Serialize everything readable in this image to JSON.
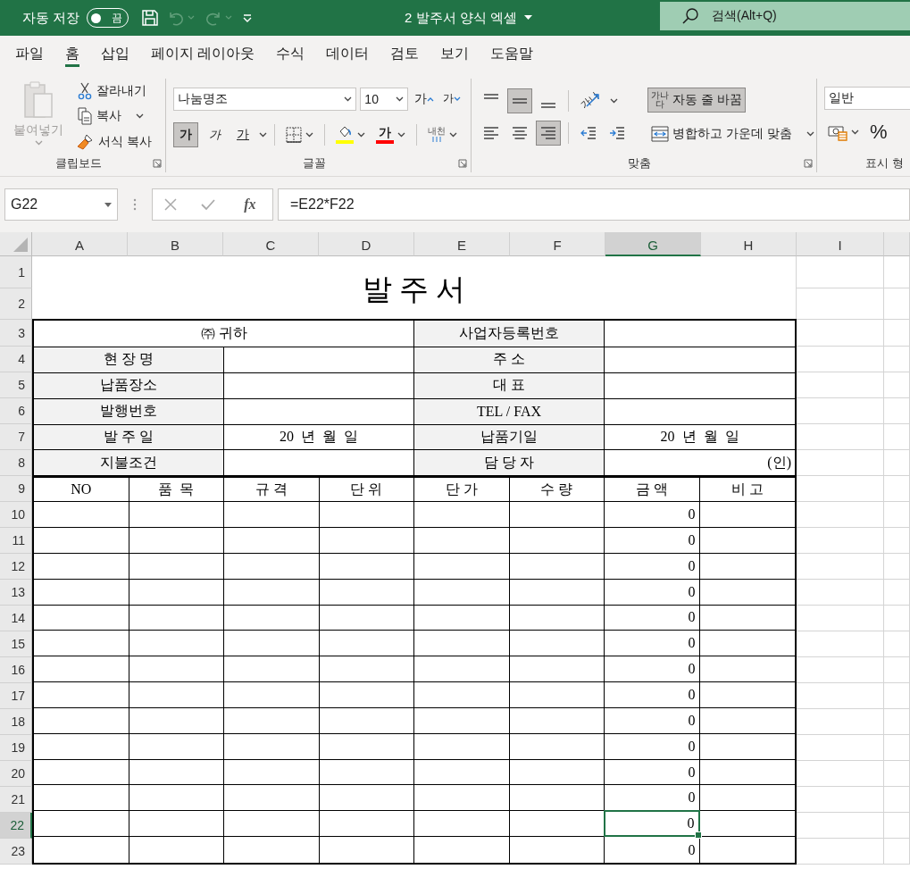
{
  "title_bar": {
    "autosave_label": "자동 저장",
    "autosave": {
      "state_label": "끔",
      "on": false
    },
    "quick_access": [
      {
        "kind": "save",
        "disabled": false
      },
      {
        "kind": "undo",
        "disabled": true
      },
      {
        "kind": "redo",
        "disabled": true
      },
      {
        "kind": "customize",
        "disabled": false
      }
    ],
    "document_title": "2 발주서 양식 엑셀",
    "search_placeholder": "검색(Alt+Q)"
  },
  "menu_tabs": [
    {
      "label": "파일",
      "selected": false
    },
    {
      "label": "홈",
      "selected": true
    },
    {
      "label": "삽입",
      "selected": false
    },
    {
      "label": "페이지 레이아웃",
      "selected": false
    },
    {
      "label": "수식",
      "selected": false
    },
    {
      "label": "데이터",
      "selected": false
    },
    {
      "label": "검토",
      "selected": false
    },
    {
      "label": "보기",
      "selected": false
    },
    {
      "label": "도움말",
      "selected": false
    }
  ],
  "ribbon": {
    "clipboard": {
      "label": "클립보드",
      "paste": {
        "label": "붙여넣기",
        "disabled": true
      },
      "commands": [
        {
          "label": "잘라내기",
          "has_menu": false
        },
        {
          "label": "복사",
          "has_menu": true
        },
        {
          "label": "서식 복사",
          "has_menu": false
        }
      ]
    },
    "font": {
      "label": "글꼴",
      "font_name": "나눔명조",
      "font_size": "10",
      "grow": "가",
      "shrink": "가",
      "styles": [
        {
          "label": "가",
          "selected": true
        },
        {
          "label": "가",
          "selected": false
        },
        {
          "label": "가",
          "selected": false
        }
      ],
      "fill_color": {
        "color": "#ffff00"
      },
      "font_color": {
        "label": "가",
        "color": "#ff0000"
      },
      "phonetic": "내천"
    },
    "alignment": {
      "label": "맞춤",
      "vertical": [
        {
          "selected": false
        },
        {
          "selected": true
        },
        {
          "selected": false
        }
      ],
      "orientation": "가나",
      "wrap": {
        "label": "자동 줄 바꿈",
        "icon_text": "가나다",
        "selected": true
      },
      "horizontal": [
        {
          "selected": false
        },
        {
          "selected": false
        },
        {
          "selected": true
        }
      ],
      "merge": {
        "label": "병합하고 가운데 맞춤"
      }
    },
    "number": {
      "label": "표시 형",
      "format": "일반",
      "percent": "%"
    }
  },
  "formula_bar": {
    "name_box": "G22",
    "function_label": "fx",
    "formula": "=E22*F22"
  },
  "sheet": {
    "columns": [
      {
        "label": "A",
        "selected": false
      },
      {
        "label": "B",
        "selected": false
      },
      {
        "label": "C",
        "selected": false
      },
      {
        "label": "D",
        "selected": false
      },
      {
        "label": "E",
        "selected": false
      },
      {
        "label": "F",
        "selected": false
      },
      {
        "label": "G",
        "selected": true
      },
      {
        "label": "H",
        "selected": false
      },
      {
        "label": "I",
        "selected": false
      }
    ],
    "rows": [
      {
        "label": "1",
        "selected": false
      },
      {
        "label": "2",
        "selected": false
      },
      {
        "label": "3",
        "selected": false
      },
      {
        "label": "4",
        "selected": false
      },
      {
        "label": "5",
        "selected": false
      },
      {
        "label": "6",
        "selected": false
      },
      {
        "label": "7",
        "selected": false
      },
      {
        "label": "8",
        "selected": false
      },
      {
        "label": "9",
        "selected": false
      },
      {
        "label": "10",
        "selected": false
      },
      {
        "label": "11",
        "selected": false
      },
      {
        "label": "12",
        "selected": false
      },
      {
        "label": "13",
        "selected": false
      },
      {
        "label": "14",
        "selected": false
      },
      {
        "label": "15",
        "selected": false
      },
      {
        "label": "16",
        "selected": false
      },
      {
        "label": "17",
        "selected": false
      },
      {
        "label": "18",
        "selected": false
      },
      {
        "label": "19",
        "selected": false
      },
      {
        "label": "20",
        "selected": false
      },
      {
        "label": "21",
        "selected": false
      },
      {
        "label": "22",
        "selected": true
      },
      {
        "label": "23",
        "selected": false
      }
    ],
    "form": {
      "title": "발 주 서",
      "info_rows": [
        {
          "kind": "recipient",
          "text": "㈜ 귀하",
          "right_label": "사업자등록번호"
        },
        {
          "kind": "pair",
          "left_label": "현 장 명",
          "right_label": "주 소"
        },
        {
          "kind": "pair",
          "left_label": "납품장소",
          "right_label": "대 표"
        },
        {
          "kind": "pair",
          "left_label": "발행번호",
          "right_label": "TEL / FAX"
        },
        {
          "kind": "pair",
          "left_label": "발 주 일",
          "left_value": {
            "kind": "date",
            "text": "20  년  월  일"
          },
          "right_label": "납품기일",
          "right_value": {
            "kind": "date",
            "text": "20  년  월  일"
          }
        },
        {
          "kind": "pair",
          "left_label": "지불조건",
          "right_label": "담 당 자",
          "right_value": {
            "kind": "seal",
            "text": "(인)"
          }
        }
      ],
      "item_columns": [
        "NO",
        "품  목",
        "규 격",
        "단 위",
        "단 가",
        "수 량",
        "금 액",
        "비 고"
      ],
      "item_rows": [
        {
          "amount": "0",
          "selected": false
        },
        {
          "amount": "0",
          "selected": false
        },
        {
          "amount": "0",
          "selected": false
        },
        {
          "amount": "0",
          "selected": false
        },
        {
          "amount": "0",
          "selected": false
        },
        {
          "amount": "0",
          "selected": false
        },
        {
          "amount": "0",
          "selected": false
        },
        {
          "amount": "0",
          "selected": false
        },
        {
          "amount": "0",
          "selected": false
        },
        {
          "amount": "0",
          "selected": false
        },
        {
          "amount": "0",
          "selected": false
        },
        {
          "amount": "0",
          "selected": false
        },
        {
          "amount": "0",
          "selected": true
        },
        {
          "amount": "0",
          "selected": false
        }
      ]
    }
  }
}
